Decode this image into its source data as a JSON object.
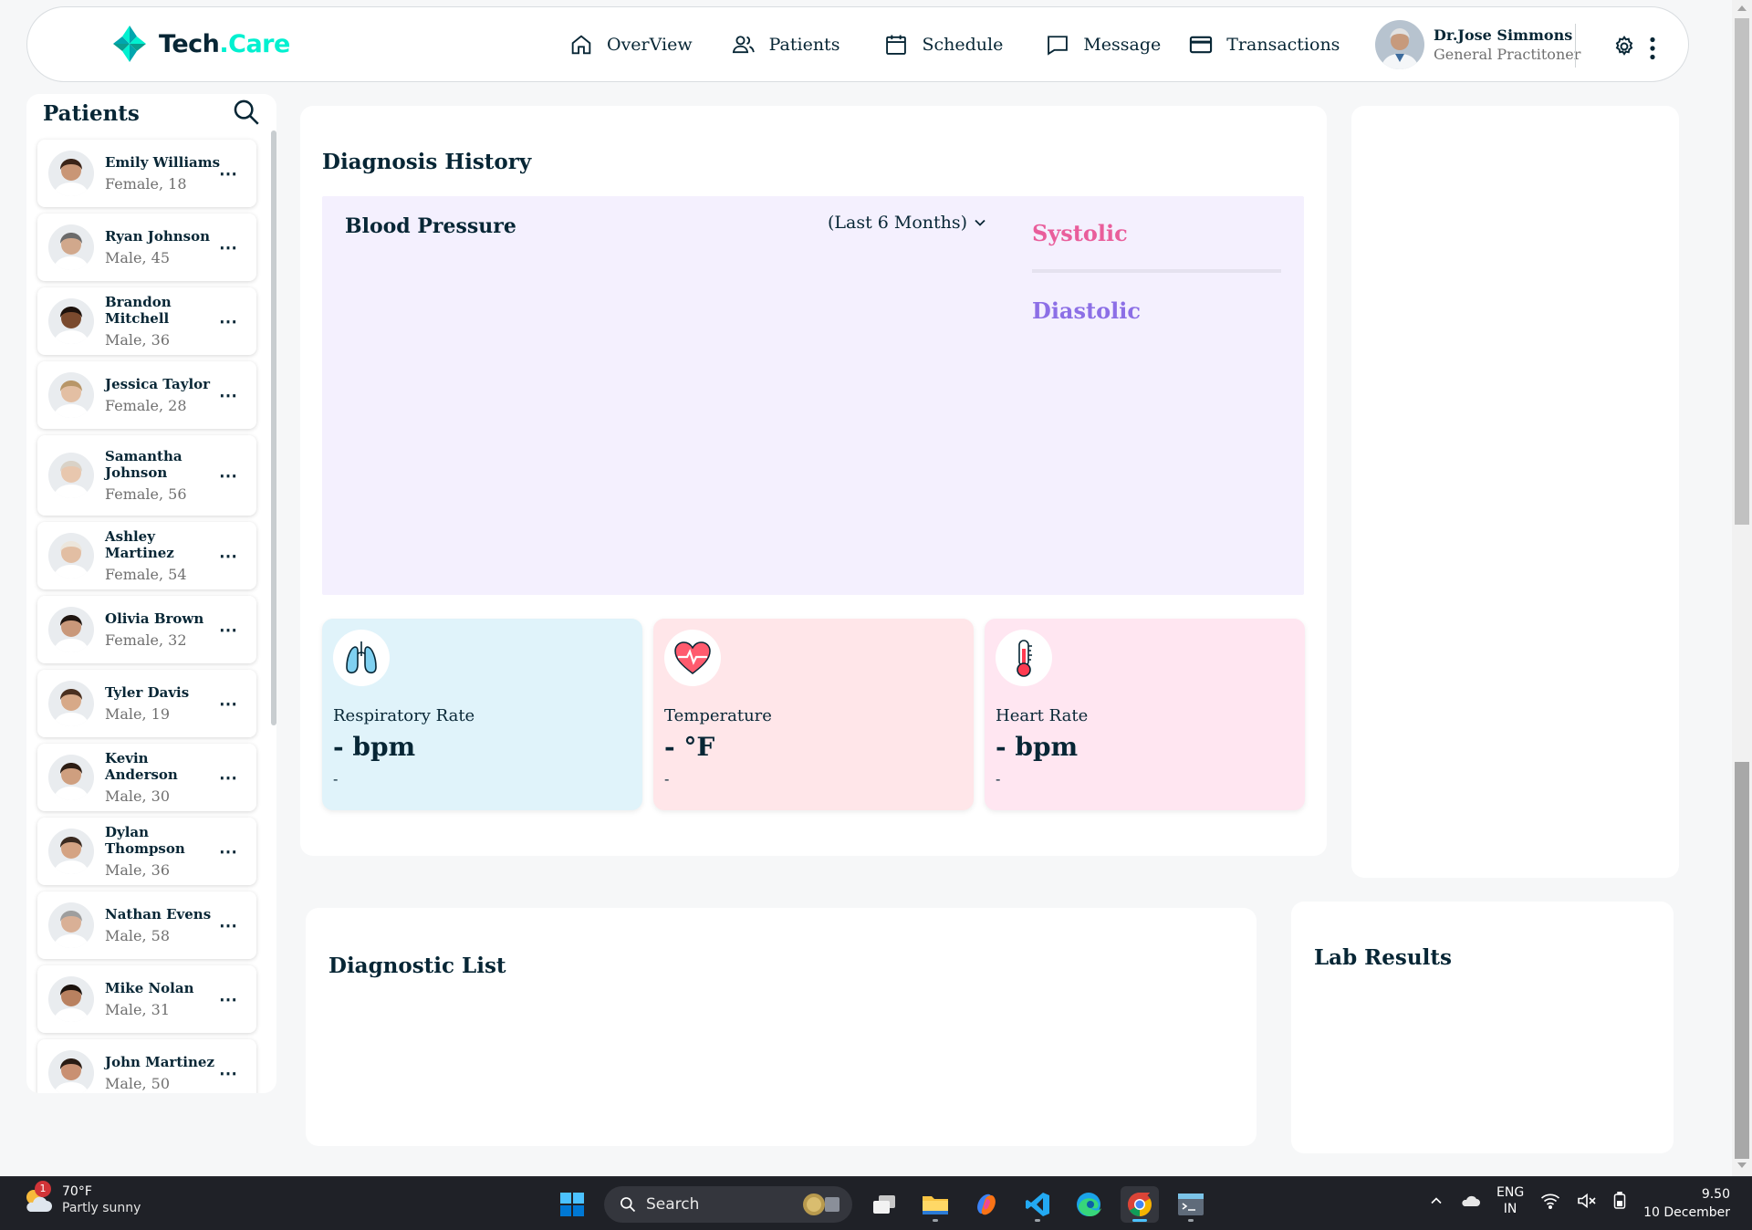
{
  "app": {
    "logo_name": "Tech",
    "logo_suffix": ".Care"
  },
  "nav": {
    "items": [
      {
        "label": "OverView",
        "icon": "home-icon"
      },
      {
        "label": "Patients",
        "icon": "users-icon"
      },
      {
        "label": "Schedule",
        "icon": "calendar-icon"
      },
      {
        "label": "Message",
        "icon": "chat-icon"
      },
      {
        "label": "Transactions",
        "icon": "credit-card-icon"
      }
    ]
  },
  "doctor": {
    "name": "Dr.Jose Simmons",
    "role": "General Practitoner"
  },
  "sidebar": {
    "title": "Patients",
    "patients": [
      {
        "name": "Emily Williams",
        "meta": "Female, 18",
        "skin": "#c99676",
        "hair": "#3b2418"
      },
      {
        "name": "Ryan Johnson",
        "meta": "Male, 45",
        "skin": "#d1a88c",
        "hair": "#6b6b6b"
      },
      {
        "name": "Brandon Mitchell",
        "meta": "Male, 36",
        "skin": "#7a4a2e",
        "hair": "#1d120c"
      },
      {
        "name": "Jessica Taylor",
        "meta": "Female, 28",
        "skin": "#e3bfa3",
        "hair": "#b89668"
      },
      {
        "name": "Samantha Johnson",
        "meta": "Female, 56",
        "skin": "#e8c7ae",
        "hair": "#d9d2c7"
      },
      {
        "name": "Ashley Martinez",
        "meta": "Female, 54",
        "skin": "#e2bea3",
        "hair": "#ece6dc"
      },
      {
        "name": "Olivia Brown",
        "meta": "Female, 32",
        "skin": "#c9987a",
        "hair": "#1f1510"
      },
      {
        "name": "Tyler Davis",
        "meta": "Male, 19",
        "skin": "#d7a988",
        "hair": "#4a3020"
      },
      {
        "name": "Kevin Anderson",
        "meta": "Male, 30",
        "skin": "#cf9f7f",
        "hair": "#2c1d14"
      },
      {
        "name": "Dylan Thompson",
        "meta": "Male, 36",
        "skin": "#d4a383",
        "hair": "#3a2a20"
      },
      {
        "name": "Nathan Evens",
        "meta": "Male, 58",
        "skin": "#d9b096",
        "hair": "#9e9e9e"
      },
      {
        "name": "Mike Nolan",
        "meta": "Male, 31",
        "skin": "#b98160",
        "hair": "#1b120d"
      },
      {
        "name": "John Martinez",
        "meta": "Male, 50",
        "skin": "#c99072",
        "hair": "#2a1c14"
      }
    ]
  },
  "diagnosis": {
    "title": "Diagnosis History",
    "bp_title": "Blood Pressure",
    "range": "(Last 6 Months)",
    "legend_systolic": "Systolic",
    "legend_diastolic": "Diastolic",
    "vitals": [
      {
        "label": "Respiratory Rate",
        "value": "- bpm",
        "note": "-",
        "icon": "lungs-icon"
      },
      {
        "label": "Temperature",
        "value": "- °F",
        "note": "-",
        "icon": "heart-monitor-icon"
      },
      {
        "label": "Heart Rate",
        "value": "- bpm",
        "note": "-",
        "icon": "thermometer-icon"
      }
    ]
  },
  "diagnostic_list": {
    "title": "Diagnostic List"
  },
  "lab_results": {
    "title": "Lab Results"
  },
  "taskbar": {
    "weather_temp": "70°F",
    "weather_cond": "Partly sunny",
    "weather_badge": "1",
    "search_label": "Search",
    "lang_1": "ENG",
    "lang_2": "IN",
    "time": "9.50",
    "date": "10 December"
  },
  "colors": {
    "navy": "#072635",
    "bp_panel": "#f4f0fe",
    "systolic": "#e95e9b",
    "diastolic": "#8c6fe6",
    "resp_bg": "#e0f3fa",
    "temp_bg": "#ffe6e9",
    "heart_bg": "#ffe6f1",
    "accent": "#01f0d0"
  }
}
